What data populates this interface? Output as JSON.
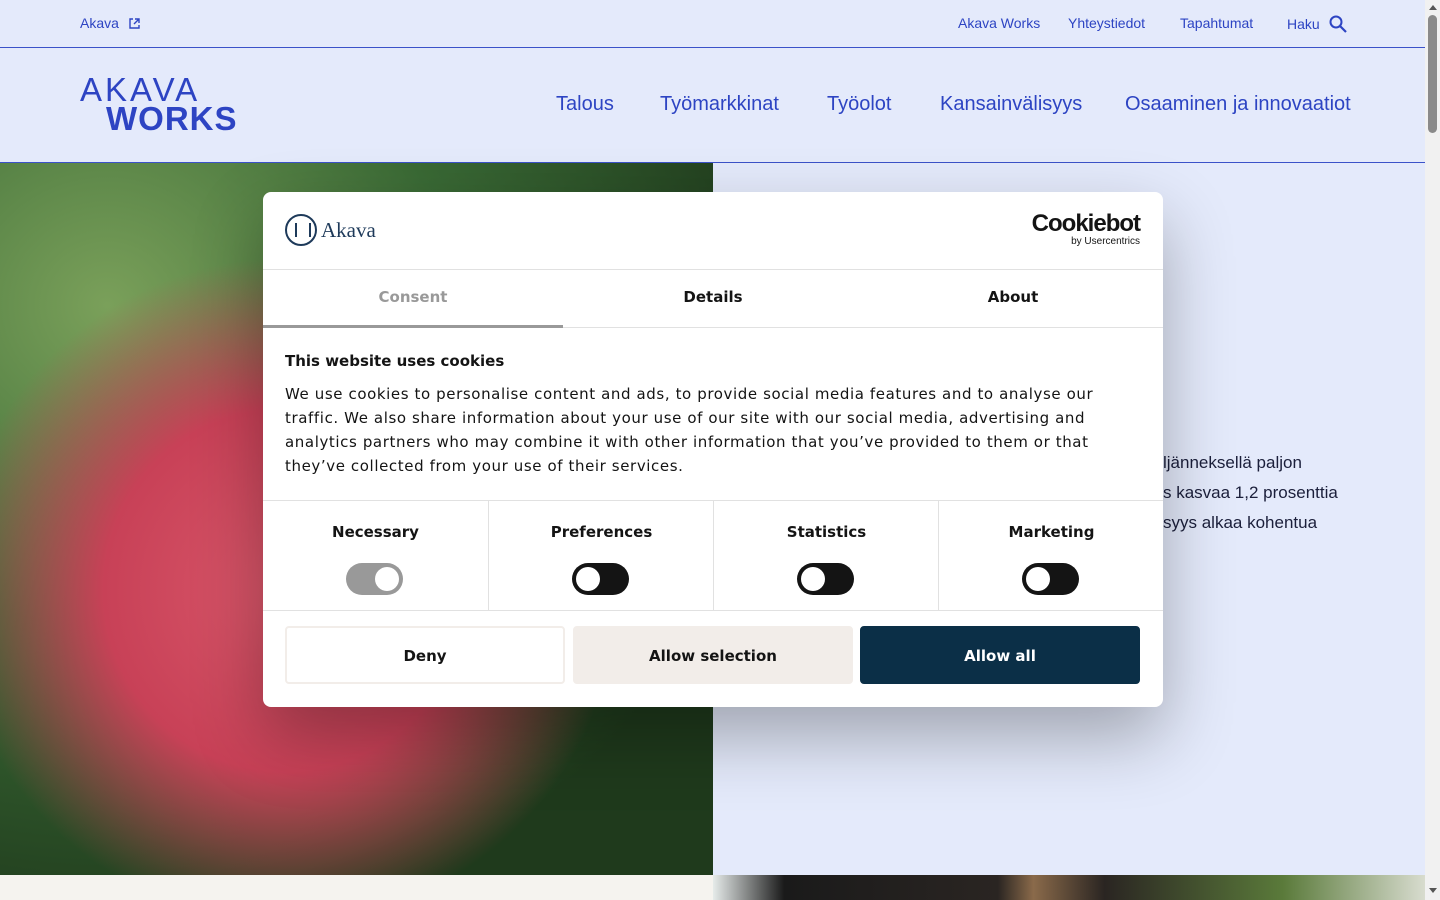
{
  "topbar": {
    "akava_link": "Akava",
    "links": [
      "Akava Works",
      "Yhteystiedot",
      "Tapahtumat",
      "Haku"
    ]
  },
  "logo": {
    "line1": "AKAVA",
    "line2": "WORKS"
  },
  "nav": {
    "items": [
      "Talous",
      "Työmarkkinat",
      "Työolot",
      "Kansainvälisyys",
      "Osaaminen ja innovaatiot"
    ]
  },
  "hero": {
    "text": "ljänneksellä paljon\ns kasvaa 1,2 prosenttia\nsyys alkaa kohentua"
  },
  "cookie": {
    "brand": "Akava",
    "cookiebot": "Cookiebot",
    "cookiebot_sub": "by Usercentrics",
    "tabs": [
      "Consent",
      "Details",
      "About"
    ],
    "title": "This website uses cookies",
    "body": "We use cookies to personalise content and ads, to provide social media features and to analyse our traffic. We also share information about your use of our site with our social media, advertising and analytics partners who may combine it with other information that you’ve provided to them or that they’ve collected from your use of their services.",
    "categories": [
      "Necessary",
      "Preferences",
      "Statistics",
      "Marketing"
    ],
    "buttons": {
      "deny": "Deny",
      "allow_selection": "Allow selection",
      "allow_all": "Allow all"
    }
  },
  "colors": {
    "brand_blue": "#2d44c3",
    "page_bg": "#e4eafb",
    "allow_all_bg": "#0b2f47",
    "secondary_btn_bg": "#f2ede9"
  }
}
